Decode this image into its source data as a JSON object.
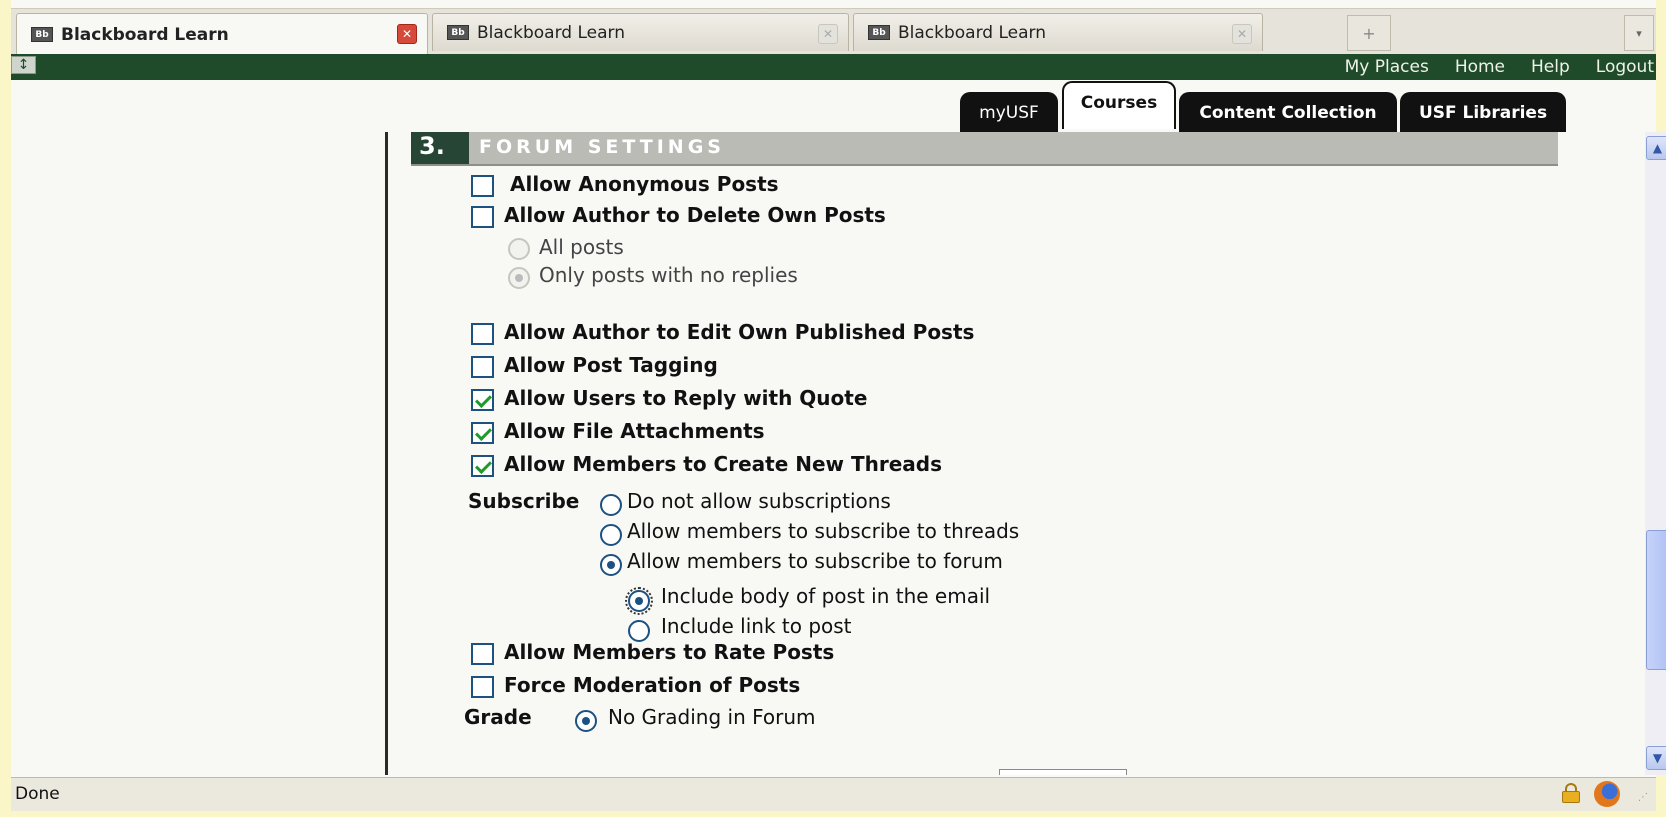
{
  "browser": {
    "tabs": [
      {
        "title": "Blackboard Learn",
        "active": true
      },
      {
        "title": "Blackboard Learn",
        "active": false
      },
      {
        "title": "Blackboard Learn",
        "active": false
      }
    ],
    "tab_icon": "Bb",
    "new_tab": "+",
    "all_tabs": "▾",
    "status_text": "Done"
  },
  "topnav": {
    "links": [
      "My Places",
      "Home",
      "Help",
      "Logout"
    ],
    "toggle": "↕"
  },
  "main_tabs": {
    "myusf": "myUSF",
    "courses": "Courses",
    "content_collection": "Content Collection",
    "usf_libraries": "USF Libraries"
  },
  "section": {
    "number": "3.",
    "title": "FORUM SETTINGS"
  },
  "settings": {
    "anonymous": {
      "label": "Allow Anonymous Posts",
      "checked": false
    },
    "delete_own": {
      "label": "Allow Author to Delete Own Posts",
      "checked": false
    },
    "delete_all_posts": {
      "label": "All posts",
      "selected": false
    },
    "delete_no_replies": {
      "label": "Only posts with no replies",
      "selected": true
    },
    "edit_own": {
      "label": "Allow Author to Edit Own Published Posts",
      "checked": false
    },
    "tagging": {
      "label": "Allow Post Tagging",
      "checked": false
    },
    "reply_quote": {
      "label": "Allow Users to Reply with Quote",
      "checked": true
    },
    "file_attachments": {
      "label": "Allow File Attachments",
      "checked": true
    },
    "new_threads": {
      "label": "Allow Members to Create New Threads",
      "checked": true
    },
    "rate_posts": {
      "label": "Allow Members to Rate Posts",
      "checked": false
    },
    "moderation": {
      "label": "Force Moderation of Posts",
      "checked": false
    }
  },
  "subscribe": {
    "label": "Subscribe",
    "options": [
      {
        "label": "Do not allow subscriptions",
        "selected": false
      },
      {
        "label": "Allow members to subscribe to threads",
        "selected": false
      },
      {
        "label": "Allow members to subscribe to forum",
        "selected": true
      }
    ],
    "sub_options": [
      {
        "label": "Include body of post in the email",
        "selected": true
      },
      {
        "label": "Include link to post",
        "selected": false
      }
    ]
  },
  "grade": {
    "label": "Grade",
    "option": "No Grading in Forum",
    "selected": true
  }
}
